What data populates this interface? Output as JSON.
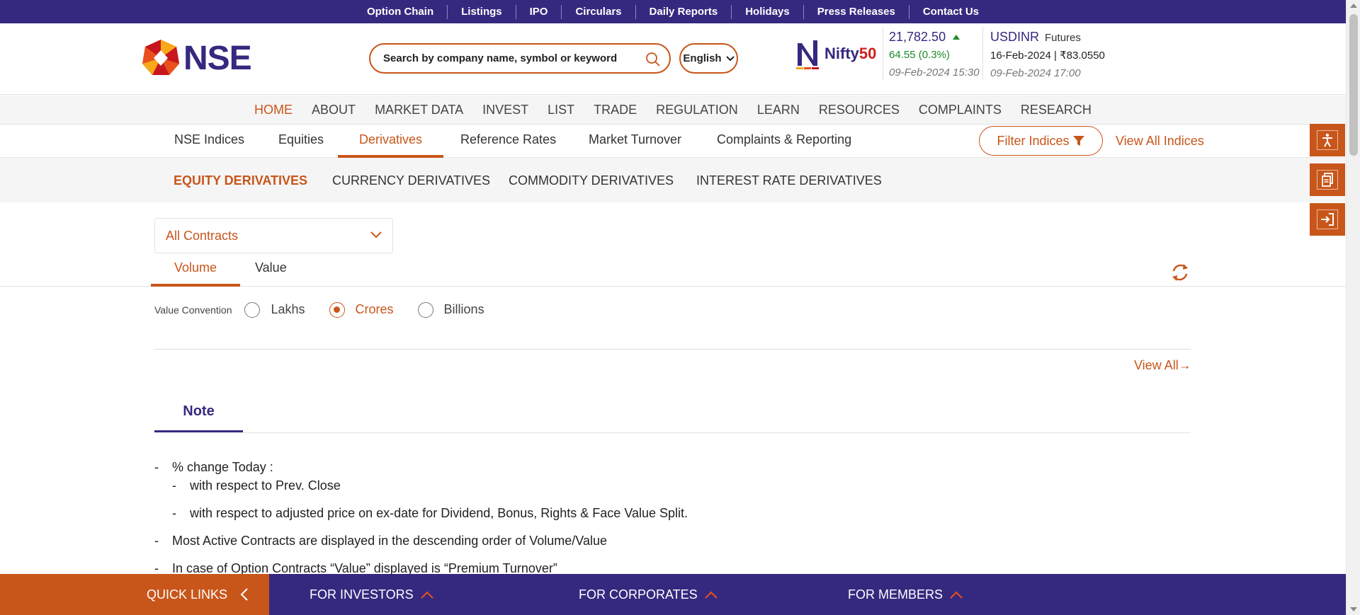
{
  "topbar": {
    "links": [
      "Option Chain",
      "Listings",
      "IPO",
      "Circulars",
      "Daily Reports",
      "Holidays",
      "Press Releases",
      "Contact Us"
    ]
  },
  "header": {
    "logo_text": "NSE",
    "search_placeholder": "Search by company name, symbol or keyword",
    "language": "English",
    "nifty": {
      "label_prefix": "Nifty",
      "label_suffix": "50",
      "value": "21,782.50",
      "change": "64.55 (0.3%)",
      "datetime": "09-Feb-2024 15:30"
    },
    "usdinr": {
      "symbol": "USDINR",
      "type": "Futures",
      "expiry_price": "16-Feb-2024 | ₹83.0550",
      "datetime": "09-Feb-2024 17:00"
    }
  },
  "main_nav": {
    "items": [
      "HOME",
      "ABOUT",
      "MARKET DATA",
      "INVEST",
      "LIST",
      "TRADE",
      "REGULATION",
      "LEARN",
      "RESOURCES",
      "COMPLAINTS",
      "RESEARCH"
    ],
    "active": "HOME"
  },
  "index_tabs": {
    "items": [
      "NSE Indices",
      "Equities",
      "Derivatives",
      "Reference Rates",
      "Market Turnover",
      "Complaints & Reporting"
    ],
    "active": "Derivatives",
    "filter_label": "Filter Indices",
    "view_all_label": "View All Indices"
  },
  "derivative_types": {
    "items": [
      "EQUITY DERIVATIVES",
      "CURRENCY DERIVATIVES",
      "COMMODITY DERIVATIVES",
      "INTEREST RATE DERIVATIVES"
    ],
    "active": "EQUITY DERIVATIVES"
  },
  "contracts_select": {
    "value": "All Contracts"
  },
  "value_tabs": {
    "items": [
      "Volume",
      "Value"
    ],
    "active": "Volume"
  },
  "value_convention": {
    "label": "Value Convention",
    "options": [
      "Lakhs",
      "Crores",
      "Billions"
    ],
    "selected": "Crores"
  },
  "view_all_label": "View All→",
  "note": {
    "title": "Note",
    "lines": [
      {
        "text": "% change Today :"
      },
      {
        "text": "with respect to Prev. Close"
      },
      {
        "text": "with respect to adjusted price on ex-date for Dividend, Bonus, Rights & Face Value Split."
      },
      {
        "text": "Most Active Contracts are displayed in the descending order of Volume/Value"
      },
      {
        "text": "In case of Option Contracts “Value” displayed is “Premium Turnover”"
      }
    ]
  },
  "bottom_bar": {
    "quick_links": "QUICK LINKS",
    "items": [
      "FOR INVESTORS",
      "FOR CORPORATES",
      "FOR MEMBERS"
    ]
  },
  "colors": {
    "brand_purple": "#35297f",
    "accent_orange": "#c8561a",
    "positive_green": "#1d8a2a"
  },
  "icons": {
    "floating": [
      "accessibility-icon",
      "document-icon",
      "login-icon"
    ]
  }
}
